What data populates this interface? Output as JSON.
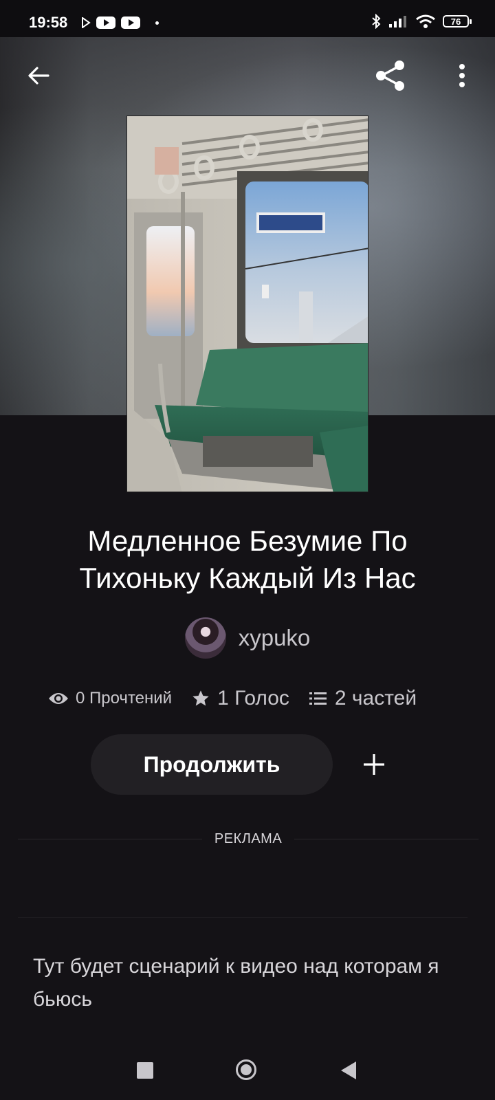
{
  "status_bar": {
    "time": "19:58",
    "battery": "76",
    "icons": [
      "play-store-icon",
      "youtube-icon",
      "youtube-icon",
      "dot-icon",
      "bluetooth-icon",
      "signal-icon",
      "wifi-icon",
      "battery-icon"
    ]
  },
  "toolbar": {
    "back_icon": "arrow-left-icon",
    "share_icon": "share-icon",
    "more_icon": "more-vertical-icon"
  },
  "story": {
    "title": "Медленное Безумие По Тихоньку Каждый Из Нас",
    "author": "xypuko",
    "reads": "0 Прочтений",
    "votes": "1 Голос",
    "parts": "2 частей",
    "continue_label": "Продолжить",
    "add_icon": "plus-icon",
    "ad_label": "РЕКЛАМА",
    "description": "Тут будет сценарий к видео над которам я бьюсь"
  },
  "nav_bar": {
    "icons": [
      "recent-apps-icon",
      "home-icon",
      "back-icon"
    ]
  },
  "colors": {
    "background": "#141216",
    "button_bg": "#222024",
    "text_secondary": "#c9c7cc"
  }
}
